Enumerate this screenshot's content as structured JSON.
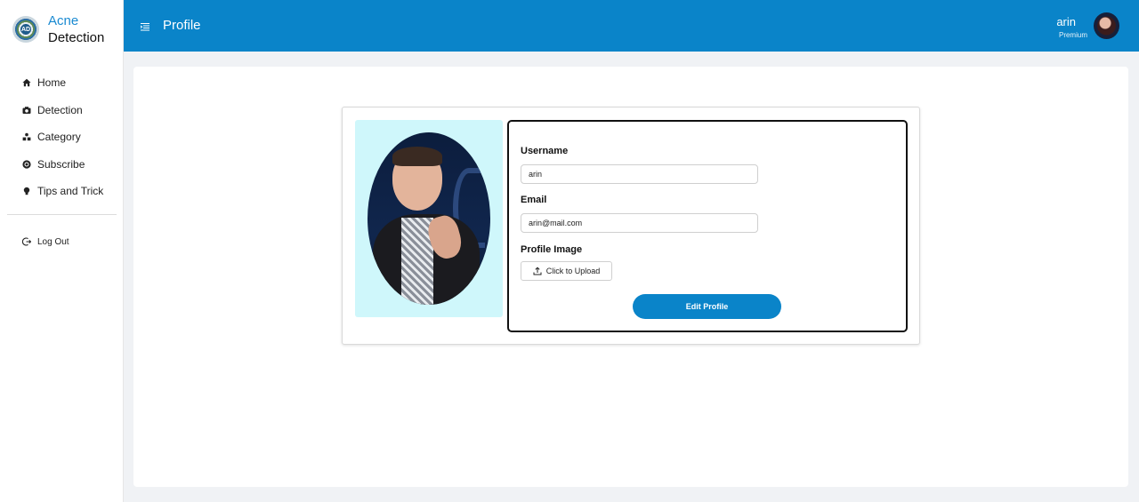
{
  "brand": {
    "title_line1": "Acne",
    "title_line2": "Detection",
    "logo_text": "AD"
  },
  "sidebar": {
    "items": [
      {
        "label": "Home",
        "icon": "home-icon"
      },
      {
        "label": "Detection",
        "icon": "camera-icon"
      },
      {
        "label": "Category",
        "icon": "category-icon"
      },
      {
        "label": "Subscribe",
        "icon": "subscribe-icon"
      },
      {
        "label": "Tips and Trick",
        "icon": "lightbulb-icon"
      }
    ],
    "logout_label": "Log Out"
  },
  "header": {
    "title": "Profile",
    "user_name": "arin",
    "user_tier": "Premium"
  },
  "profile": {
    "username_label": "Username",
    "username_value": "arin",
    "email_label": "Email",
    "email_value": "arin@mail.com",
    "image_label": "Profile Image",
    "upload_label": "Click to Upload",
    "submit_label": "Edit Profile"
  },
  "colors": {
    "primary": "#0a84c9",
    "photo_bg": "#cff7fb",
    "page_bg": "#f0f2f5"
  }
}
